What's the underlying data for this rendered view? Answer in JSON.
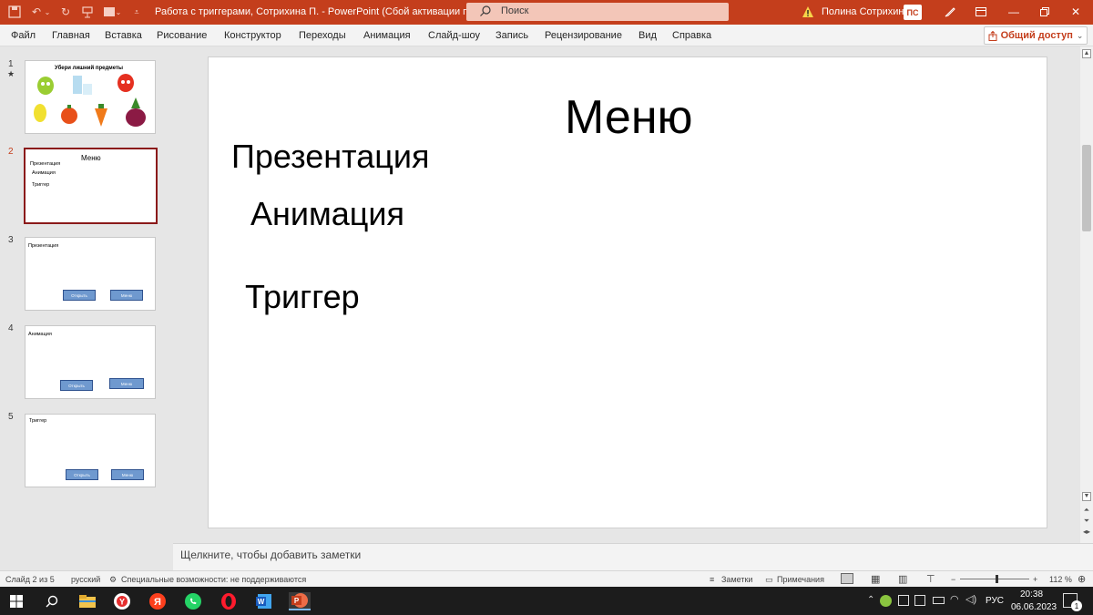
{
  "window": {
    "title": "Работа с триггерами, Сотрихина П.  -  PowerPoint (Сбой активации проду...",
    "search_placeholder": "Поиск",
    "user_name": "Полина Сотрихина",
    "user_initials": "ПС",
    "accent_color": "#c43e1c"
  },
  "ribbon": {
    "tabs": [
      "Файл",
      "Главная",
      "Вставка",
      "Рисование",
      "Конструктор",
      "Переходы",
      "Анимация",
      "Слайд-шоу",
      "Запись",
      "Рецензирование",
      "Вид",
      "Справка"
    ],
    "share_label": "Общий доступ"
  },
  "thumbnails": [
    {
      "number": "1",
      "star": "★",
      "title": "Убери лишний предметы"
    },
    {
      "number": "2",
      "title": "Меню",
      "items": [
        "Презентация",
        "Анимация",
        "Триггер"
      ]
    },
    {
      "number": "3",
      "title": "Презентация",
      "btn_open": "Открыть",
      "btn_menu": "Меню"
    },
    {
      "number": "4",
      "title": "Анимация",
      "btn_open": "Открыть",
      "btn_menu": "Меню"
    },
    {
      "number": "5",
      "title": "Триггер",
      "btn_open": "Открыть",
      "btn_menu": "Меню"
    }
  ],
  "slide": {
    "title": "Меню",
    "item1": "Презентация",
    "item2": "Анимация",
    "item3": "Триггер"
  },
  "notes_placeholder": "Щелкните, чтобы добавить заметки",
  "status": {
    "slide_counter": "Слайд 2 из 5",
    "language": "русский",
    "accessibility": "Специальные возможности: не поддерживаются",
    "notes_label": "Заметки",
    "comments_label": "Примечания",
    "zoom": "112 %",
    "zoom_minus": "−",
    "zoom_plus": "+"
  },
  "taskbar": {
    "lang": "РУС",
    "time": "20:38",
    "date": "06.06.2023",
    "notif_count": "1",
    "apps": [
      "windows-start",
      "search",
      "file-explorer",
      "yandex-browser",
      "yandex",
      "whatsapp",
      "opera",
      "word",
      "powerpoint"
    ]
  }
}
